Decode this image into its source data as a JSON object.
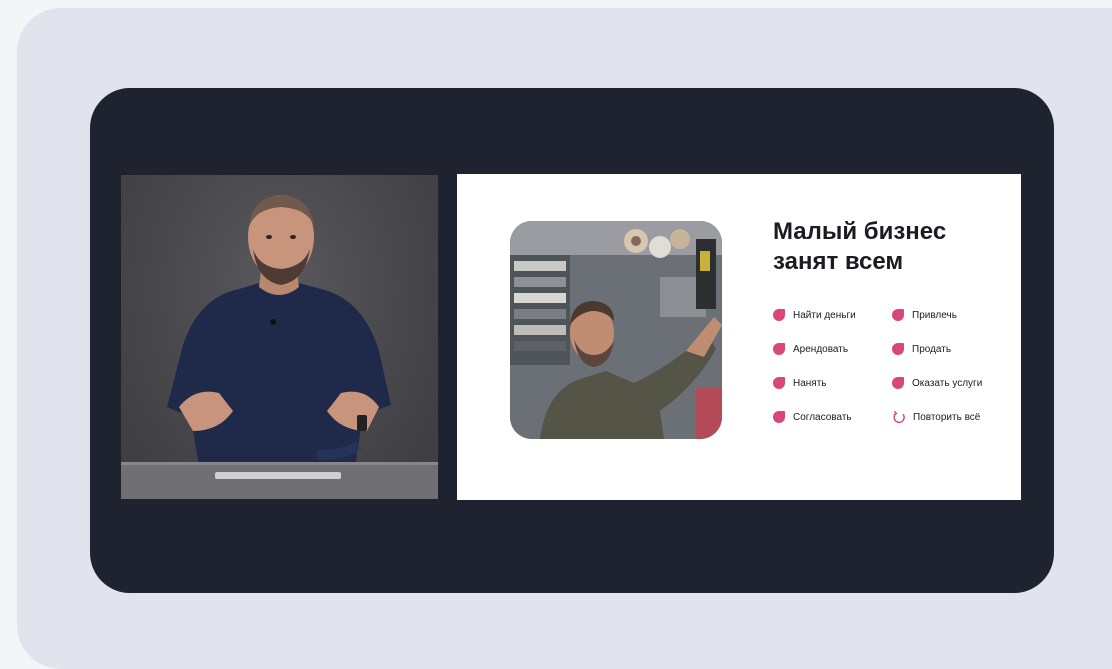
{
  "slide": {
    "title_line1": "Малый бизнес",
    "title_line2": "занят всем",
    "tasks_left": [
      "Найти деньги",
      "Арендовать",
      "Нанять",
      "Согласовать"
    ],
    "tasks_right": [
      "Привлечь",
      "Продать",
      "Оказать услуги",
      "Повторить всё"
    ]
  },
  "colors": {
    "page_background": "#f4f5f8",
    "card_background": "#e2e4ed",
    "player_frame": "#1f2330",
    "slide_background": "#ffffff",
    "accent_pink": "#d9467a",
    "text_dark": "#1b1c22"
  },
  "icons": {
    "bullet": "petal-icon",
    "last_item": "repeat-icon"
  }
}
